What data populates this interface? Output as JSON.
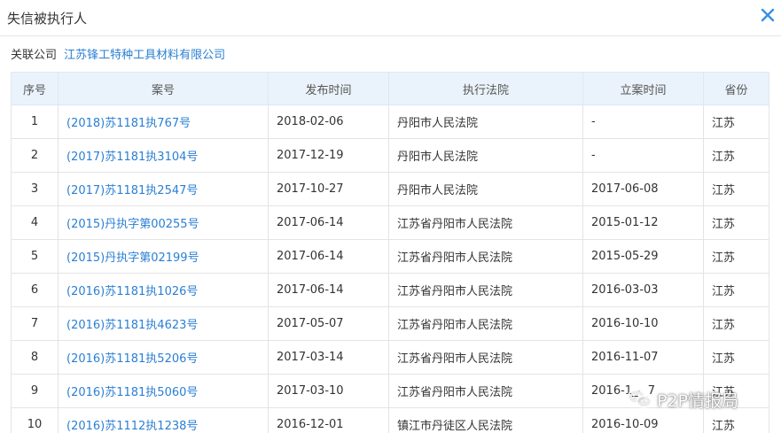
{
  "dialog": {
    "title": "失信被执行人"
  },
  "company": {
    "label": "关联公司",
    "name": "江苏锋工特种工具材料有限公司"
  },
  "table": {
    "headers": [
      "序号",
      "案号",
      "发布时间",
      "执行法院",
      "立案时间",
      "省份"
    ],
    "rows": [
      [
        "1",
        "(2018)苏1181执767号",
        "2018-02-06",
        "丹阳市人民法院",
        "-",
        "江苏"
      ],
      [
        "2",
        "(2017)苏1181执3104号",
        "2017-12-19",
        "丹阳市人民法院",
        "-",
        "江苏"
      ],
      [
        "3",
        "(2017)苏1181执2547号",
        "2017-10-27",
        "丹阳市人民法院",
        "2017-06-08",
        "江苏"
      ],
      [
        "4",
        "(2015)丹执字第00255号",
        "2017-06-14",
        "江苏省丹阳市人民法院",
        "2015-01-12",
        "江苏"
      ],
      [
        "5",
        "(2015)丹执字第02199号",
        "2017-06-14",
        "江苏省丹阳市人民法院",
        "2015-05-29",
        "江苏"
      ],
      [
        "6",
        "(2016)苏1181执1026号",
        "2017-06-14",
        "江苏省丹阳市人民法院",
        "2016-03-03",
        "江苏"
      ],
      [
        "7",
        "(2016)苏1181执4623号",
        "2017-05-07",
        "江苏省丹阳市人民法院",
        "2016-10-10",
        "江苏"
      ],
      [
        "8",
        "(2016)苏1181执5206号",
        "2017-03-14",
        "江苏省丹阳市人民法院",
        "2016-11-07",
        "江苏"
      ],
      [
        "9",
        "(2016)苏1181执5060号",
        "2017-03-10",
        "江苏省丹阳市人民法院",
        "2016-1_-_7",
        "江苏"
      ],
      [
        "10",
        "(2016)苏1112执1238号",
        "2016-12-01",
        "镇江市丹徒区人民法院",
        "2016-10-09",
        "江苏"
      ]
    ]
  },
  "watermark": {
    "text": "P2P情报局"
  },
  "colors": {
    "link": "#2a7fd4",
    "header_bg": "#eaf3fb",
    "close_icon": "#3a8ee6"
  }
}
